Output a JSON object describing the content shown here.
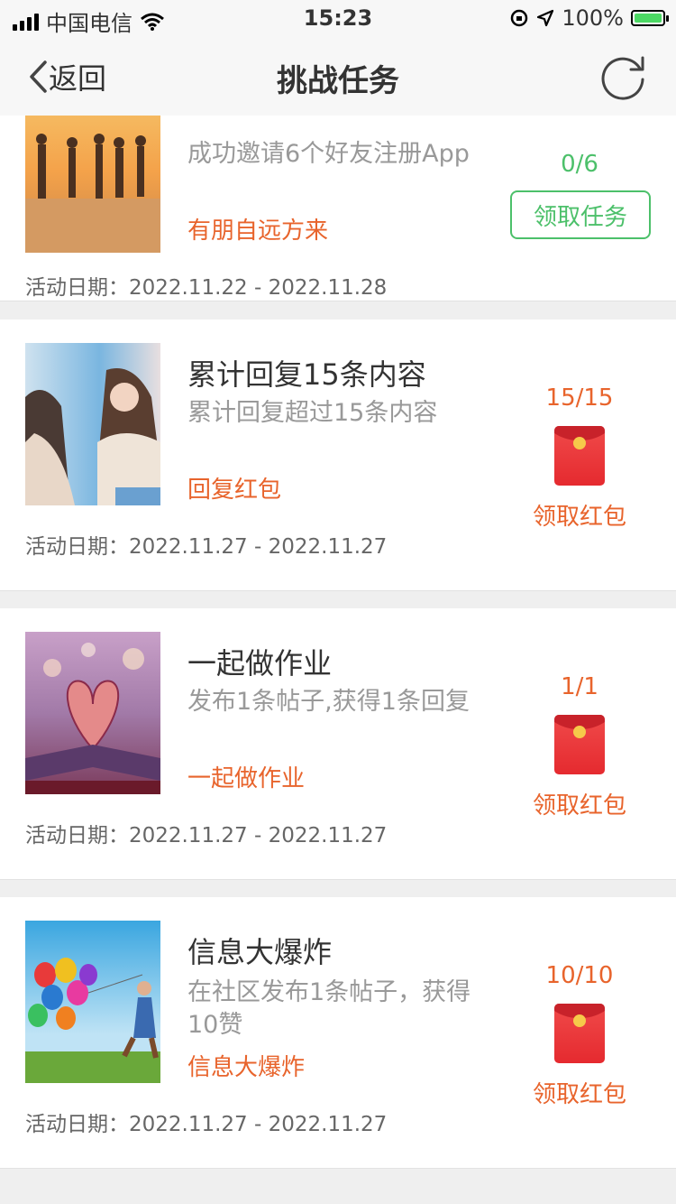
{
  "status_bar": {
    "carrier": "中国电信",
    "time": "15:23",
    "battery": "100%"
  },
  "nav": {
    "back_label": "返回",
    "title": "挑战任务"
  },
  "date_label": "活动日期：",
  "tasks": [
    {
      "title": "",
      "desc": "成功邀请6个好友注册App",
      "tag": "有朋自远方来",
      "dates": "2022.11.22 - 2022.11.28",
      "progress": "0/6",
      "action": "领取任务",
      "state": "pending"
    },
    {
      "title": "累计回复15条内容",
      "desc": "累计回复超过15条内容",
      "tag": "回复红包",
      "dates": "2022.11.27 - 2022.11.27",
      "progress": "15/15",
      "action": "领取红包",
      "state": "complete"
    },
    {
      "title": "一起做作业",
      "desc": "发布1条帖子,获得1条回复",
      "tag": "一起做作业",
      "dates": "2022.11.27 - 2022.11.27",
      "progress": "1/1",
      "action": "领取红包",
      "state": "complete"
    },
    {
      "title": "信息大爆炸",
      "desc": "在社区发布1条帖子，获得10赞",
      "tag": "信息大爆炸",
      "dates": "2022.11.27 - 2022.11.27",
      "progress": "10/10",
      "action": "领取红包",
      "state": "complete"
    }
  ],
  "colors": {
    "accent_orange": "#e8642c",
    "accent_green": "#4cc06a",
    "red_packet": "#e52a2f"
  }
}
